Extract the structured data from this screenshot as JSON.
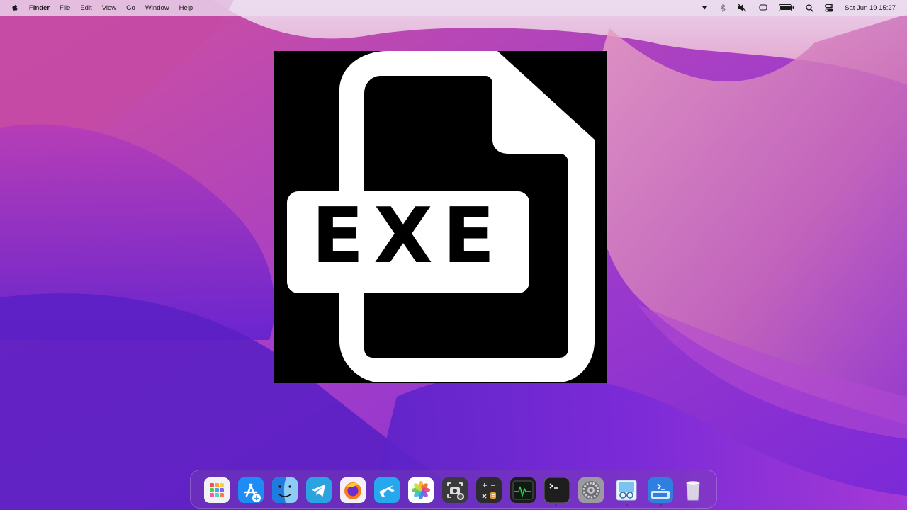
{
  "menubar": {
    "app_menu": "Finder",
    "menus": [
      "File",
      "Edit",
      "View",
      "Go",
      "Window",
      "Help"
    ],
    "clock": "Sat Jun 19  15:27"
  },
  "status_icons": [
    "dropdown-icon",
    "bluetooth-icon",
    "sound-muted-icon",
    "screen-mirroring-icon",
    "battery-icon",
    "spotlight-search-icon",
    "control-center-icon"
  ],
  "content_image": {
    "label": "EXE",
    "background": "#000000",
    "foreground": "#ffffff"
  },
  "dock": {
    "apps": [
      "launchpad-icon",
      "app-store-icon",
      "finder-icon",
      "telegram-icon",
      "firefox-icon",
      "migration-icon",
      "photos-icon",
      "screenshot-icon",
      "calculator-icon",
      "activity-monitor-icon",
      "terminal-icon",
      "system-preferences-icon",
      "preview-icon",
      "downloads-stack-icon",
      "trash-icon"
    ]
  },
  "colors": {
    "wallpaper_pink": "#d4559a",
    "wallpaper_purple": "#6a24d6",
    "menubar_bg": "#ecdef0"
  }
}
